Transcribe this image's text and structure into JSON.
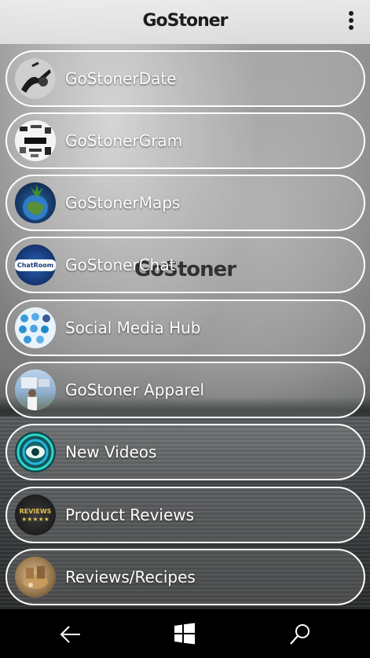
{
  "app": {
    "title": "GoStoner",
    "watermark": "GoStoner"
  },
  "menu": {
    "items": [
      {
        "label": "GoStonerDate",
        "icon": "dating-photo-icon"
      },
      {
        "label": "GoStonerGram",
        "icon": "social-media-collage-icon"
      },
      {
        "label": "GoStonerMaps",
        "icon": "globe-leaf-icon"
      },
      {
        "label": "GoStonerChat",
        "icon": "chatroom-icon"
      },
      {
        "label": "Social Media Hub",
        "icon": "social-hub-icon"
      },
      {
        "label": "GoStoner Apparel",
        "icon": "apparel-photo-icon"
      },
      {
        "label": "New Videos",
        "icon": "eye-video-icon"
      },
      {
        "label": "Product Reviews",
        "icon": "reviews-stars-icon"
      },
      {
        "label": "Reviews/Recipes",
        "icon": "recipes-photo-icon"
      }
    ],
    "chat_thumb_text": "ChatRoom",
    "reviews_thumb_text": "REVIEWS"
  },
  "colors": {
    "item_border": "#ffffff",
    "label_text": "#ffffff",
    "navbar": "#000000"
  }
}
